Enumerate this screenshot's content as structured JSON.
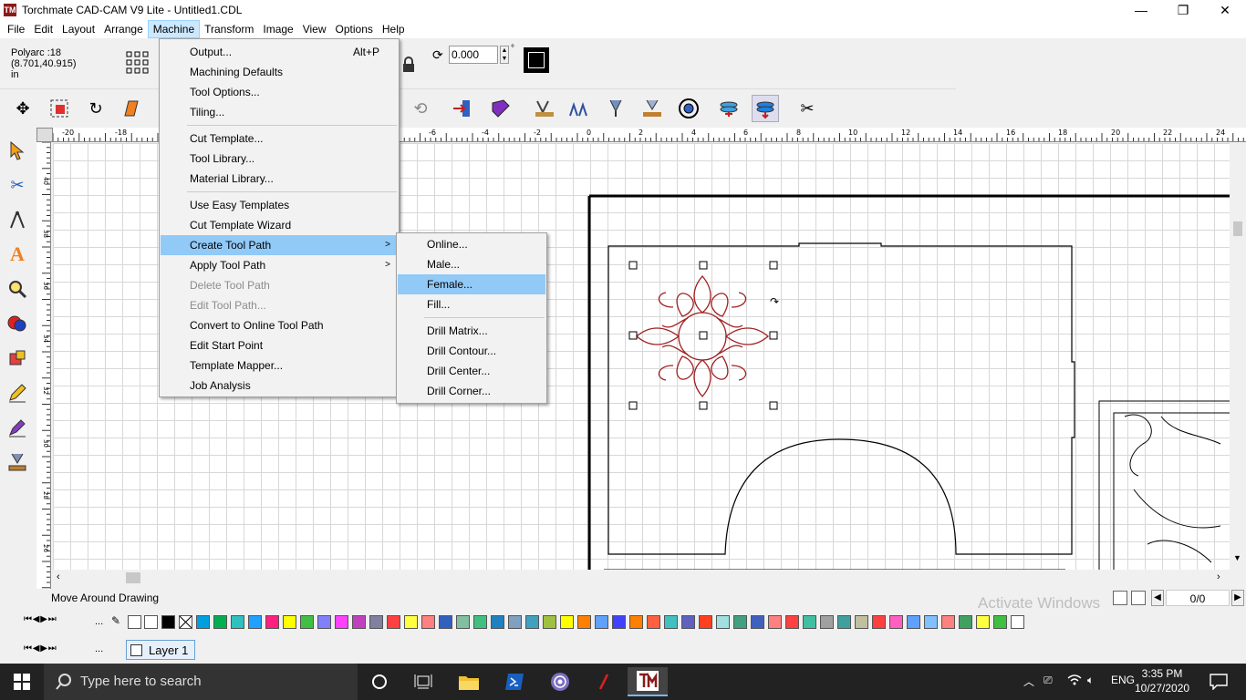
{
  "window": {
    "title": "Torchmate CAD-CAM V9 Lite - Untitled1.CDL",
    "logo_text": "TM",
    "minimize": "—",
    "maximize": "❐",
    "close": "✕"
  },
  "menubar": [
    "File",
    "Edit",
    "Layout",
    "Arrange",
    "Machine",
    "Transform",
    "Image",
    "View",
    "Options",
    "Help"
  ],
  "propbar": {
    "object_line1": "Polyarc :18",
    "object_line2": "(8.701,40.915)",
    "object_line3": "in",
    "rotation_value": "0.000",
    "degree_symbol": "°"
  },
  "machine_menu": {
    "items": [
      {
        "label": "Output...",
        "shortcut": "Alt+P"
      },
      {
        "label": "Machining Defaults"
      },
      {
        "label": "Tool Options..."
      },
      {
        "label": "Tiling..."
      },
      {
        "label": "Cut Template..."
      },
      {
        "label": "Tool Library..."
      },
      {
        "label": "Material Library..."
      },
      {
        "label": "Use Easy Templates"
      },
      {
        "label": "Cut Template Wizard"
      },
      {
        "label": "Create Tool Path"
      },
      {
        "label": "Apply Tool Path"
      },
      {
        "label": "Delete Tool Path"
      },
      {
        "label": "Edit Tool Path..."
      },
      {
        "label": "Convert to Online Tool Path"
      },
      {
        "label": "Edit Start Point"
      },
      {
        "label": "Template Mapper..."
      },
      {
        "label": "Job Analysis"
      }
    ]
  },
  "submenu": {
    "items": [
      "Online...",
      "Male...",
      "Female...",
      "Fill...",
      "Drill Matrix...",
      "Drill Contour...",
      "Drill Center...",
      "Drill Corner..."
    ]
  },
  "hruler_labels": [
    "-20",
    "-18",
    "-6",
    "-4",
    "-2",
    "0",
    "2",
    "4",
    "6",
    "8",
    "10",
    "12",
    "14",
    "16",
    "18",
    "20",
    "22",
    "24"
  ],
  "vruler_labels": [
    "40",
    "38",
    "36",
    "34",
    "32",
    "30",
    "28",
    "26"
  ],
  "status": {
    "message": "Move Around Drawing",
    "page_counter": "0/0",
    "watermark": "Activate Windows"
  },
  "palette_colors": [
    "#00a0e0",
    "#00b050",
    "#30c0c0",
    "#20a0ff",
    "#ff2080",
    "#ffff00",
    "#40c040",
    "#8080ff",
    "#ff40ff",
    "#c040c0",
    "#8080a0",
    "#ff4040",
    "#ffff40",
    "#ff8080",
    "#3060c0",
    "#80c0a0",
    "#40c080",
    "#2080c0",
    "#80a0c0",
    "#40a0c0",
    "#a0c040",
    "#ffff00",
    "#ff8000",
    "#60a0ff",
    "#4040ff",
    "#ff8000",
    "#ff6040",
    "#40c0c0",
    "#6060c0",
    "#ff4020",
    "#a0e0e0",
    "#40a080",
    "#4060c0",
    "#ff8080",
    "#ff4040",
    "#40c0a0",
    "#a0a0a0",
    "#40a0a0",
    "#c0c0a0",
    "#ff4040",
    "#ff60c0",
    "#60a0ff",
    "#80c0ff",
    "#ff8080",
    "#40a060",
    "#ffff40",
    "#40c040",
    "#ffffff"
  ],
  "layer": {
    "name": "Layer 1",
    "nav_more": "..."
  },
  "taskbar": {
    "search_placeholder": "Type here to search",
    "language": "ENG",
    "time": "3:35 PM",
    "date": "10/27/2020"
  }
}
